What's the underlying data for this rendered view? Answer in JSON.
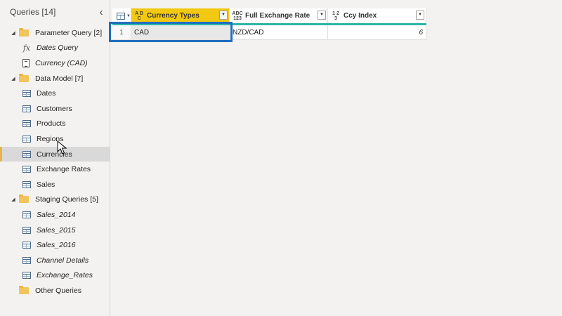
{
  "queries_pane": {
    "title": "Queries [14]",
    "collapse_glyph": "‹",
    "groups": [
      {
        "name": "Parameter Query [2]",
        "items": [
          {
            "label": "Dates Query",
            "icon": "fx-icon",
            "italic": true
          },
          {
            "label": "Currency (CAD)",
            "icon": "parameter-icon",
            "italic": true
          }
        ]
      },
      {
        "name": "Data Model [7]",
        "items": [
          {
            "label": "Dates",
            "icon": "table-icon",
            "italic": false
          },
          {
            "label": "Customers",
            "icon": "table-icon",
            "italic": false
          },
          {
            "label": "Products",
            "icon": "table-icon",
            "italic": false
          },
          {
            "label": "Regions",
            "icon": "table-icon",
            "italic": false
          },
          {
            "label": "Currencies",
            "icon": "table-icon",
            "italic": false,
            "selected": true
          },
          {
            "label": "Exchange Rates",
            "icon": "table-icon",
            "italic": false
          },
          {
            "label": "Sales",
            "icon": "table-icon",
            "italic": false
          }
        ]
      },
      {
        "name": "Staging Queries [5]",
        "items": [
          {
            "label": "Sales_2014",
            "icon": "table-icon",
            "italic": true
          },
          {
            "label": "Sales_2015",
            "icon": "table-icon",
            "italic": true
          },
          {
            "label": "Sales_2016",
            "icon": "table-icon",
            "italic": true
          },
          {
            "label": "Channel Details",
            "icon": "table-icon",
            "italic": true
          },
          {
            "label": "Exchange_Rates",
            "icon": "table-icon",
            "italic": true
          }
        ]
      },
      {
        "name": "Other Queries",
        "items": []
      }
    ]
  },
  "grid": {
    "columns": [
      {
        "label": "Currency Types",
        "type_icon": "ABC-text-type-icon",
        "type_top": "A B",
        "type_bottom": "C",
        "selected": true,
        "filtered": true
      },
      {
        "label": "Full Exchange Rate",
        "type_icon": "ABC-123-any-type-icon",
        "type_top": "ABC",
        "type_bottom": "123",
        "selected": false
      },
      {
        "label": "Ccy Index",
        "type_icon": "123-number-type-icon",
        "type_top": "1 2",
        "type_bottom": "3",
        "selected": false
      }
    ],
    "rows": [
      {
        "num": "1",
        "cells": [
          "CAD",
          "NZD/CAD",
          "6"
        ]
      }
    ]
  },
  "colors": {
    "accent_yellow": "#f2c811",
    "header_underline": "#2bb5a6",
    "highlight_box": "#1f6fbf",
    "folder": "#f2c45c"
  }
}
